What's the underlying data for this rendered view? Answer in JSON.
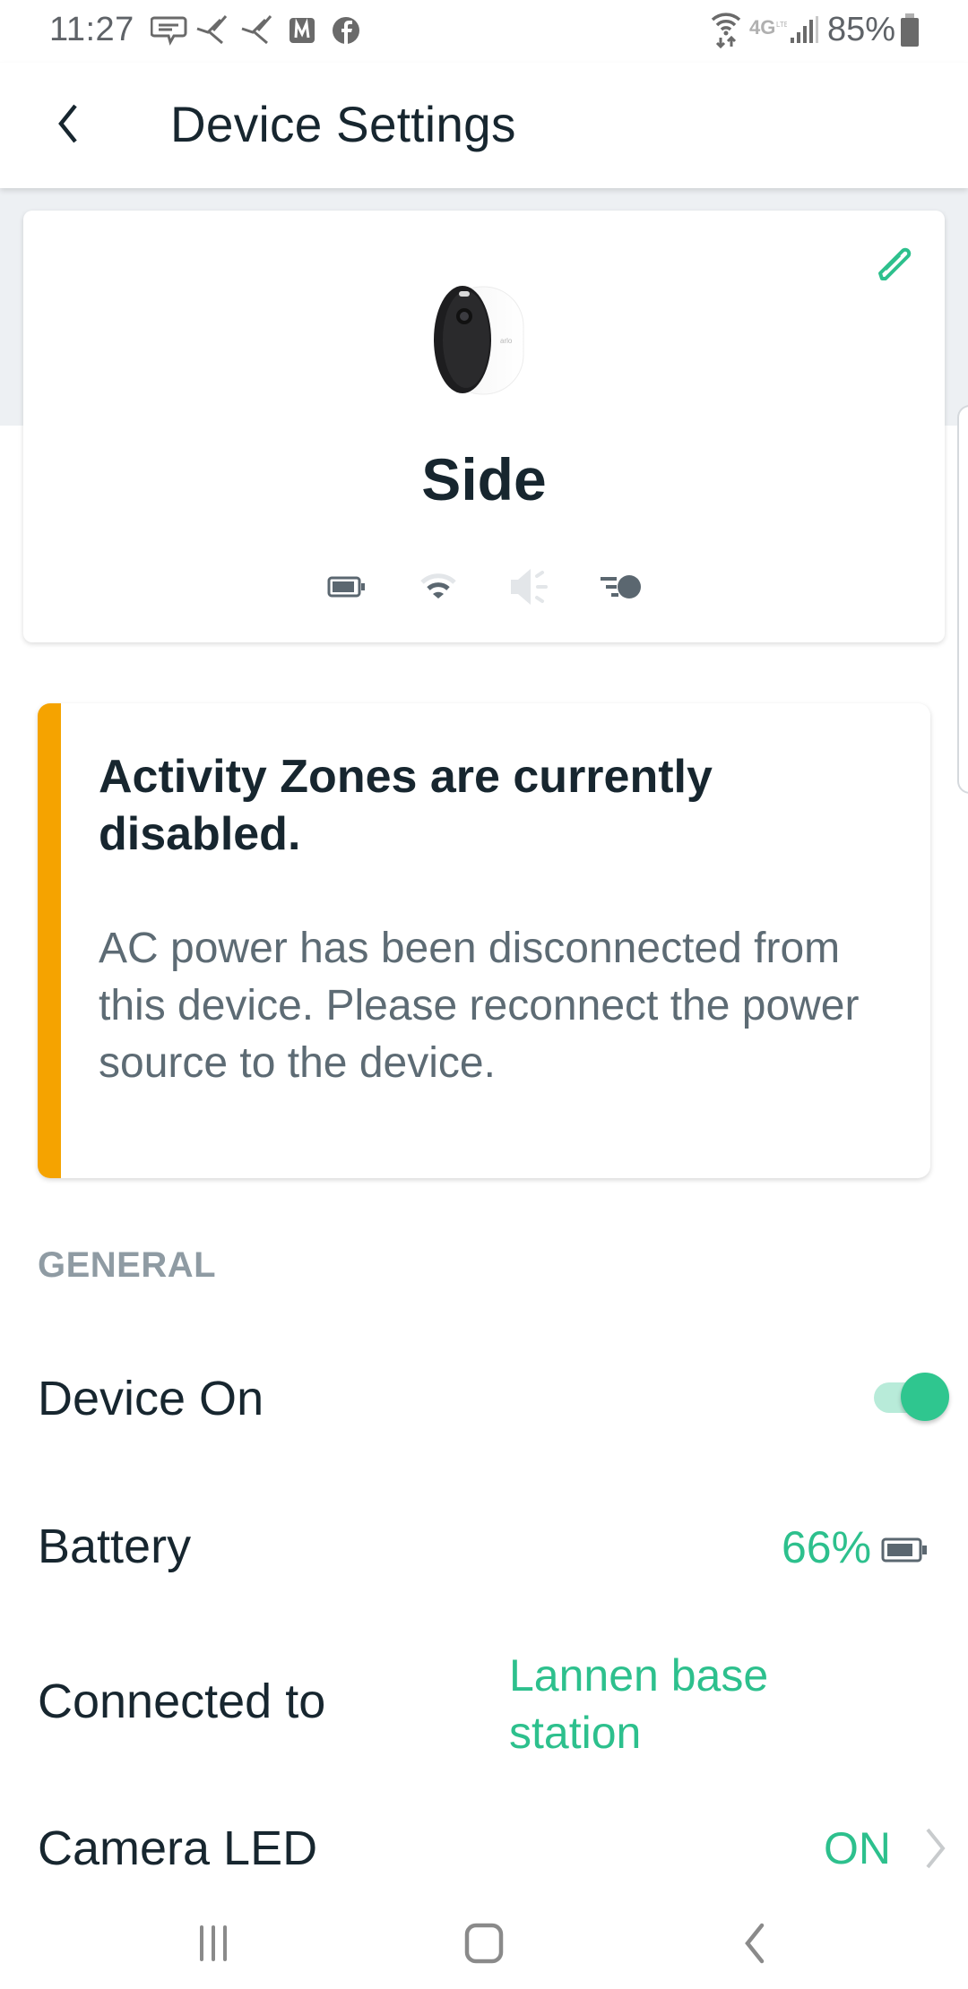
{
  "status_bar": {
    "time": "11:27",
    "notification_icons": [
      "message-icon",
      "bird-icon",
      "bird-icon",
      "m-app-icon",
      "facebook-icon"
    ],
    "system_icons": [
      "wifi-data-icon",
      "4g-lte-icon",
      "signal-icon"
    ],
    "battery_percent": "85%"
  },
  "header": {
    "back_icon": "chevron-left-icon",
    "title": "Device Settings"
  },
  "device_card": {
    "name": "Side",
    "image": "arlo-camera",
    "edit_icon": "pencil-icon",
    "status_icons": [
      {
        "name": "battery-icon",
        "state": "active"
      },
      {
        "name": "wifi-icon",
        "state": "weak-signal"
      },
      {
        "name": "speaker-icon",
        "state": "disabled"
      },
      {
        "name": "motion-icon",
        "state": "active"
      }
    ]
  },
  "alert": {
    "accent_color": "#f5a300",
    "title": "Activity Zones are currently disabled.",
    "body": "AC power has been disconnected from this device. Please reconnect the power source to the device."
  },
  "general": {
    "section_label": "GENERAL",
    "rows": [
      {
        "label": "Device On",
        "type": "toggle",
        "value": true
      },
      {
        "label": "Battery",
        "type": "value",
        "value": "66%",
        "icon": "battery-icon"
      },
      {
        "label": "Connected to",
        "type": "value",
        "value": "Lannen base station"
      },
      {
        "label": "Camera LED",
        "type": "link",
        "value": "ON",
        "icon": "chevron-right-icon"
      }
    ]
  },
  "colors": {
    "accent_green": "#2dc08d",
    "text_dark": "#17262f",
    "text_muted": "#5d6b74",
    "warning": "#f5a300"
  },
  "nav_bar": {
    "buttons": [
      "recents-icon",
      "home-icon",
      "back-icon"
    ]
  }
}
